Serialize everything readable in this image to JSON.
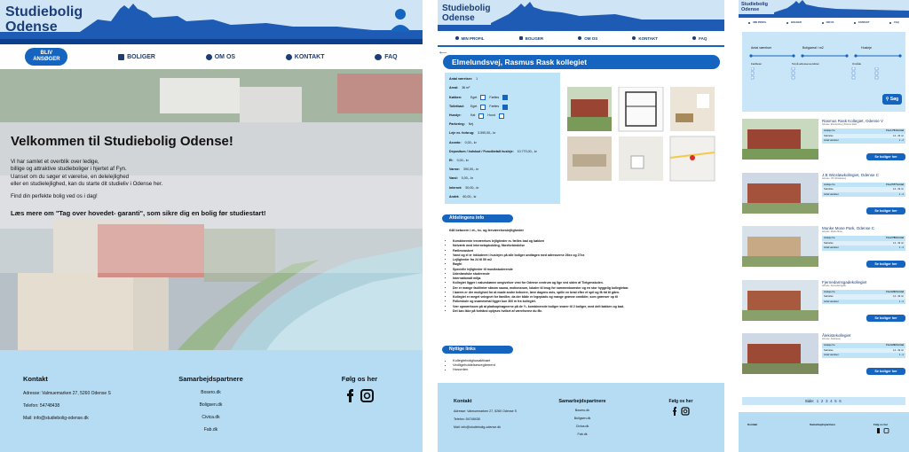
{
  "home": {
    "logo_line1": "Studiebolig",
    "logo_line2": "Odense",
    "nav": {
      "apply_line1": "BLIV",
      "apply_line2": "ANSØGER",
      "boliger": "BOLIGER",
      "om": "OM OS",
      "kontakt": "KONTAKT",
      "faq": "FAQ"
    },
    "hero": {
      "title": "Velkommen til Studiebolig Odense!",
      "p1": "Vi har samlet et overblik over ledige,",
      "p2": "billige og attraktive studieboliger i hjertet af Fyn.",
      "p3": "Uanset om du søger et værelse, en delelejlighed",
      "p4": "eller en studielejlighed, kan du starte dit studieliv i Odense her.",
      "p5": "Find din perfekte bolig ved os i dag!",
      "more": "Læs mere om \"Tag over hovedet- garanti\", som sikre dig en bolig før studiestart!"
    },
    "footer": {
      "kontakt": "Kontakt",
      "adresse": "Adresse: Valmuemarken 27, 5260 Odense S",
      "telefon": "Telefon: 54748438",
      "mail": "Mail: info@studiebolig-odense.dk",
      "partners_title": "Samarbejdspartnere",
      "partners": [
        "Bosero.dk",
        "Boligsen.dk",
        "Civica.dk",
        "Fab.dk"
      ],
      "follow": "Følg os her"
    }
  },
  "detail": {
    "logo_line1": "Studiebolig",
    "logo_line2": "Odense",
    "nav": {
      "profile": "MIN PROFIL",
      "boliger": "BOLIGER",
      "om": "OM OS",
      "kontakt": "KONTAKT",
      "faq": "FAQ"
    },
    "title": "Elmelundsvej, Rasmus Rask kollegiet",
    "facts": [
      {
        "k": "Antal værelser:",
        "v": "1"
      },
      {
        "k": "Areal:",
        "v": "36 m²"
      },
      {
        "k": "Parkering:",
        "v": "Nej"
      },
      {
        "k": "Leje ex. forbrug:",
        "v": "3.590,00,- kr"
      },
      {
        "k": "Aconto:",
        "v": "0,00,- kr"
      },
      {
        "k": "Depositum / Indskud / Forudbetalt husleje:",
        "v": "10.770,00,- kr"
      },
      {
        "k": "El:",
        "v": "0,00,- kr"
      },
      {
        "k": "Varme:",
        "v": "390,00,- kr"
      },
      {
        "k": "Vand:",
        "v": "0,00,- kr"
      },
      {
        "k": "Internet:",
        "v": "50,00,- kr"
      },
      {
        "k": "Andet:",
        "v": "60,00,- kr"
      }
    ],
    "amen": [
      {
        "k": "Køkken:",
        "a": "Eget",
        "b": "Fælles"
      },
      {
        "k": "Toiletbad:",
        "a": "Eget",
        "b": "Fælles"
      },
      {
        "k": "Husdyr:",
        "a": "Kat",
        "b": "Hund"
      }
    ],
    "info_title": "Afdelingens info",
    "info_lead": "648 beboere i et-, to- og treværelseslejligheder",
    "bullets": [
      "Kombinerede treværelses lejligheder m. fælles bad og køkken",
      "Netværk med internetopkobling, fiberforbindelse",
      "Fællesvaskeri",
      "Vand og el er inkluderet i huslejen på alle boliger undtagen med adresserne 26xx og 27xx",
      "Lejligheder fra 24 til 59 m2",
      "Røgfri",
      "Specielle lejligheder til musikstuderende",
      "Udenlandske studerende",
      "Internationalt miljø.",
      "Kollegiet ligger i naturskønne omgivelser vest for Odense centrum og lige ved siden af Tietgenskolen.",
      "Der er mange faciliteter såsom sauna, motionsrum, lokaler til brug for sammenkomster og en stor hyggelig kollegiebar.",
      "I barem er der mulighed for at møde andre beboere, lære dagens avis, spille en brad efter et spil og få tid til gåen.",
      "Kollegiet er meget velegnet for familier, da der både er legeplads og mange grønne områder, som grænser op til",
      "Folkeskole og svømmehal ligger kun 300 m fra kollegiet.",
      "Vær opmærksom på at pladsoptrøgnerne på de ½- kombinerede boliger svarer til 2 boliger, med delt køkken og bad.",
      "Det kan ikke på forhånd oplyses hvilket af værelserne du får."
    ],
    "links_title": "Nyttige links",
    "links": [
      "Kollegiebolighusaktbaet",
      "Vedligeholdelsesreglement",
      "Husorden"
    ],
    "footer": {
      "kontakt": "Kontakt",
      "adresse": "Adresse: Valmuemarken 27, 5260 Odense S",
      "telefon": "Telefon: 54748438",
      "mail": "Mail: info@studiebolig-odense.dk",
      "partners_title": "Samarbejdspartnere",
      "partners": [
        "Bosero.dk",
        "Boligsen.dk",
        "Civica.dk",
        "Fab.dk"
      ],
      "follow": "Følg os her"
    }
  },
  "list": {
    "logo_line1": "Studiebolig",
    "logo_line2": "Odense",
    "nav": [
      "MIN PROFIL",
      "BOLIGER",
      "OM OS",
      "KONTAKT",
      "FAQ"
    ],
    "filters": {
      "rooms": "Antal værelser",
      "area": "Boligareal i m2",
      "rent": "Husleje",
      "fac": "Faciliteter",
      "pets": "Tal på adresseoversikten",
      "location": "Område",
      "search": "Søg"
    },
    "listings": [
      {
        "name": "Rasmus Rask Kollegiet, Odense V",
        "addr": "Adresse: Elmelundsvej, Rasmus Rask",
        "price": "Fra 1.754 kr./md",
        "size": "14 - 32 m²",
        "rooms": "1 - 2",
        "btn": "Se boliger her"
      },
      {
        "name": "J.B Winsløwkollegiet, Odense C",
        "addr": "Adresse: J.B. Winsløwsvej",
        "price": "Fra 2.577 kr./md",
        "size": "14 - 32 m²",
        "rooms": "1 - 2",
        "btn": "Se boliger her"
      },
      {
        "name": "Munke Mose Park, Odense C",
        "addr": "Adresse: Munke Mose",
        "price": "Fra 2.769 kr./md",
        "size": "14 - 32 m²",
        "rooms": "1 - 2",
        "btn": "Se boliger her"
      },
      {
        "name": "Fjernedamsgadekollegiet",
        "addr": "Adresse: Fjernedamsgade",
        "price": "Fra 3.222 kr./md",
        "size": "14 - 32 m²",
        "rooms": "1 - 2",
        "btn": "Se boliger her"
      },
      {
        "name": "Ålekistekollegiet",
        "addr": "Adresse: Ålekistevej",
        "price": "Fra 3.222 kr./md",
        "size": "14 - 32 m²",
        "rooms": "1 - 2",
        "btn": "Se boliger her"
      }
    ],
    "row_labels": {
      "price": "Husleje fra",
      "size": "Størrelse",
      "rooms": "Antal værelser"
    },
    "pagination_label": "Side:",
    "pages": [
      "1",
      "2",
      "3",
      "4",
      "5",
      "6"
    ],
    "footer": {
      "kontakt": "Kontakt",
      "partners_title": "Samarbejdspartnere",
      "follow": "Følg os her"
    }
  },
  "colors": {
    "brand": "#1b3d78",
    "button": "#1565c0",
    "header_bg": "#cfe5f6",
    "footer_bg": "#b5dcf3",
    "facts_bg": "#bfe3f7"
  }
}
